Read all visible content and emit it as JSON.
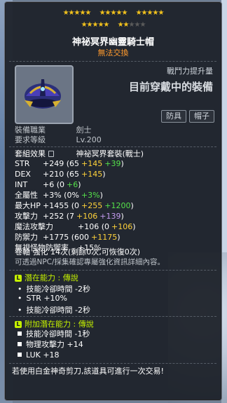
{
  "stars": {
    "filled": 17,
    "total": 20
  },
  "item": {
    "name": "神祕冥界幽靈騎士帽",
    "trade_status": "無法交換",
    "power_label": "戰鬥力提升量",
    "power_value": "目前穿戴中的裝備",
    "tags": [
      "防具",
      "帽子"
    ]
  },
  "requirements": [
    {
      "label": "裝備職業",
      "value": "劍士"
    },
    {
      "label": "要求等級",
      "value": "Lv.200"
    }
  ],
  "set_effect": {
    "label": "套組效果",
    "value": "神祕冥界套裝(戰士)"
  },
  "stats": [
    {
      "name": "STR",
      "total": "+249",
      "base": "65",
      "bonus1": "+145",
      "bonus2": "+39"
    },
    {
      "name": "DEX",
      "total": "+210",
      "base": "65",
      "bonus1": "+145",
      "bonus2": ""
    },
    {
      "name": "INT",
      "total": "+6",
      "base": "0",
      "bonus1": "",
      "bonus2": "+6"
    },
    {
      "name": "全屬性",
      "total": "+3%",
      "base": "0%",
      "bonus1": "",
      "bonus2": "+3%"
    },
    {
      "name": "最大HP",
      "total": "+1455",
      "base": "0",
      "bonus1": "+255",
      "bonus2": "+1200"
    },
    {
      "name": "攻擊力",
      "total": "+252",
      "base": "7",
      "bonus1": "+106",
      "bonus2": "+139"
    },
    {
      "name": "魔法攻擊力",
      "total": "+106",
      "base": "0",
      "bonus1": "+106",
      "bonus2": ""
    },
    {
      "name": "防禦力",
      "total": "+1775",
      "base": "600",
      "bonus1": "+1175",
      "bonus2": ""
    },
    {
      "name": "無視怪物防禦率",
      "total": "+15%",
      "base": "",
      "bonus1": "",
      "bonus2": ""
    }
  ],
  "scroll": {
    "line1": "卷軸 強化 14次(剩餘0次,可恢復0次)",
    "line2": "可透過NPC/採集確認專屬強化資訊詳細內容。"
  },
  "potential": {
    "header": "潛在能力 : 傳說",
    "badge": "L",
    "lines": [
      "技能冷卻時間 -2秒",
      "STR +10%",
      "技能冷卻時間 -2秒"
    ]
  },
  "additional_potential": {
    "header": "附加潛在能力 : 傳說",
    "badge": "L",
    "lines": [
      "技能冷卻時間 -1秒",
      "物理攻擊力 +14",
      "LUK +18"
    ]
  },
  "footer": "若使用白金神奇剪刀,該道具可進行一次交易!",
  "colors": {
    "star": "#f2c21d",
    "orange": "#ff9a2e",
    "potential": "#c4f000",
    "yellow": "#ffd23a",
    "green": "#55e14a",
    "purple": "#c49cf0"
  }
}
